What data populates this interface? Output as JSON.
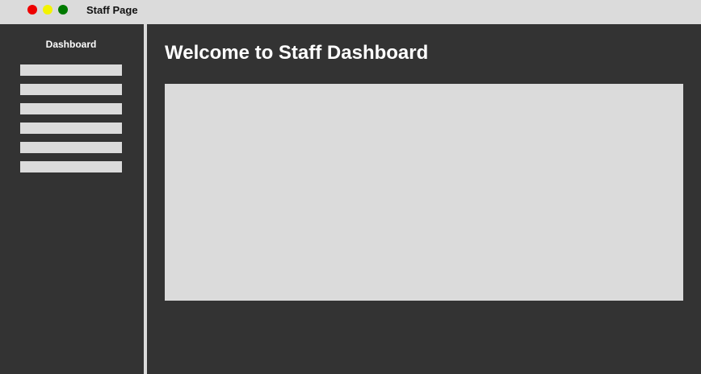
{
  "window": {
    "title": "Staff Page",
    "controls": {
      "close_color": "#ee0000",
      "minimize_color": "#f3f300",
      "maximize_color": "#007a00"
    }
  },
  "sidebar": {
    "title": "Dashboard",
    "item_color": "#dbdbdb",
    "items": [
      {
        "label": ""
      },
      {
        "label": ""
      },
      {
        "label": ""
      },
      {
        "label": ""
      },
      {
        "label": ""
      },
      {
        "label": ""
      }
    ]
  },
  "main": {
    "title": "Welcome to Staff Dashboard",
    "panel_color": "#dbdbdb"
  },
  "colors": {
    "background": "#333333",
    "titlebar": "#dbdbdb",
    "text_light": "#ffffff"
  }
}
